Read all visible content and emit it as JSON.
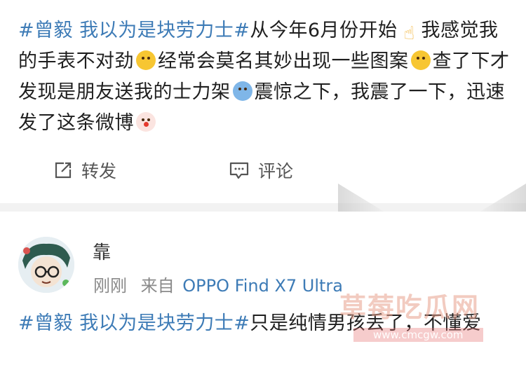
{
  "post1": {
    "hashtag": "#曾毅 我以为是块劳力士#",
    "text_a": "从今年6月份开始",
    "emoji_a": "pointing-up-hand",
    "text_b": "我感觉我的手表不对劲",
    "emoji_b": "grimacing-face",
    "text_c": "经常会莫名其妙出现一些图案",
    "emoji_c": "kissing-face",
    "text_d": "查了下才发现是朋友送我的士力架",
    "emoji_d": "screaming-face",
    "text_e": "震惊之下，我震了一下，迅速发了这条微博",
    "emoji_e": "clown-face",
    "actions": {
      "repost_label": "转发",
      "comment_label": "评论"
    }
  },
  "post2": {
    "username": "靠",
    "time": "刚刚",
    "source_prefix": "来自",
    "source": "OPPO Find X7 Ultra",
    "hashtag": "#曾毅 我以为是块劳力士#",
    "text": "只是纯情男孩丢了，不懂爱"
  },
  "watermark": {
    "main": "草莓吃瓜网",
    "sub": "www.cmcgw.com"
  },
  "colors": {
    "hashtag": "#3d7bb6",
    "divider": "#f2f2f2",
    "meta": "#8a8a8a"
  }
}
